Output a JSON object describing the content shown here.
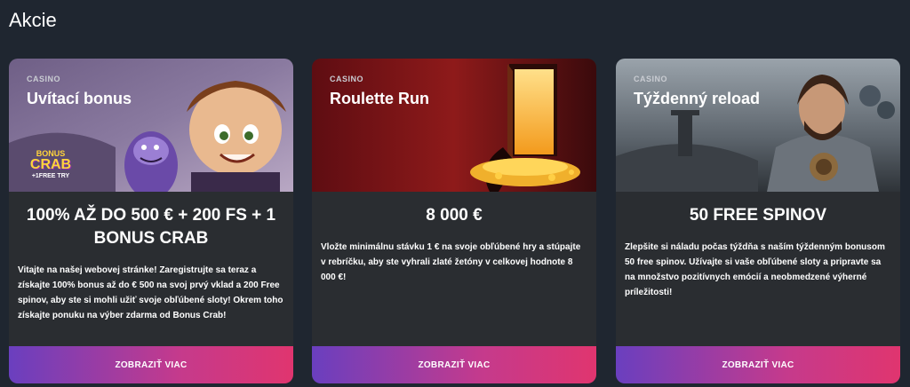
{
  "page": {
    "title": "Akcie"
  },
  "cards": [
    {
      "category": "CASINO",
      "title": "Uvítací bonus",
      "banner_logo": {
        "line1": "BONUS",
        "line2": "CRAB",
        "line3": "+1FREE TRY"
      },
      "headline": "100% AŽ DO 500 € + 200 FS + 1 BONUS CRAB",
      "description": "Vitajte na našej webovej stránke! Zaregistrujte sa teraz a získajte 100% bonus až do € 500 na svoj prvý vklad a 200 Free spinov, aby ste si mohli užiť svoje obľúbené sloty! Okrem toho získajte ponuku na výber zdarma od Bonus Crab!",
      "cta": "ZOBRAZIŤ VIAC"
    },
    {
      "category": "CASINO",
      "title": "Roulette Run",
      "headline": "8 000 €",
      "description": "Vložte minimálnu stávku 1 € na svoje obľúbené hry a stúpajte v rebríčku, aby ste vyhrali zlaté žetóny v celkovej hodnote 8 000 €!",
      "cta": "ZOBRAZIŤ VIAC"
    },
    {
      "category": "CASINO",
      "title": "Týždenný reload",
      "headline": "50 FREE SPINOV",
      "description": "Zlepšite si náladu počas týždňa s naším týždenným bonusom 50 free spinov. Užívajte si vaše obľúbené sloty a pripravte sa na množstvo pozitívnych emócií a neobmedzené výherné príležitosti!",
      "cta": "ZOBRAZIŤ VIAC"
    }
  ],
  "colors": {
    "background": "#1f2630",
    "card": "#2a2d31",
    "cta_start": "#6a3fbf",
    "cta_end": "#e0356f"
  }
}
